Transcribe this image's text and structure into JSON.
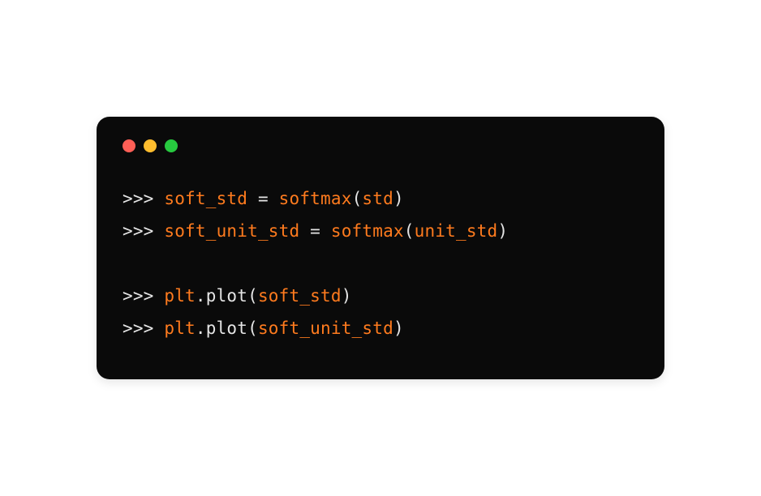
{
  "code": {
    "prompt": ">>>",
    "lines": [
      {
        "tokens": [
          {
            "kind": "orange",
            "t": "soft_std"
          },
          {
            "kind": "white",
            "t": " = "
          },
          {
            "kind": "orange",
            "t": "softmax"
          },
          {
            "kind": "white",
            "t": "("
          },
          {
            "kind": "orange",
            "t": "std"
          },
          {
            "kind": "white",
            "t": ")"
          }
        ]
      },
      {
        "tokens": [
          {
            "kind": "orange",
            "t": "soft_unit_std"
          },
          {
            "kind": "white",
            "t": " = "
          },
          {
            "kind": "orange",
            "t": "softmax"
          },
          {
            "kind": "white",
            "t": "("
          },
          {
            "kind": "orange",
            "t": "unit_std"
          },
          {
            "kind": "white",
            "t": ")"
          }
        ]
      },
      {
        "blank": true
      },
      {
        "tokens": [
          {
            "kind": "orange",
            "t": "plt"
          },
          {
            "kind": "white",
            "t": ".plot("
          },
          {
            "kind": "orange",
            "t": "soft_std"
          },
          {
            "kind": "white",
            "t": ")"
          }
        ]
      },
      {
        "tokens": [
          {
            "kind": "orange",
            "t": "plt"
          },
          {
            "kind": "white",
            "t": ".plot("
          },
          {
            "kind": "orange",
            "t": "soft_unit_std"
          },
          {
            "kind": "white",
            "t": ")"
          }
        ]
      }
    ]
  },
  "icons": {
    "close": "close-dot",
    "minimize": "minimize-dot",
    "maximize": "maximize-dot"
  }
}
